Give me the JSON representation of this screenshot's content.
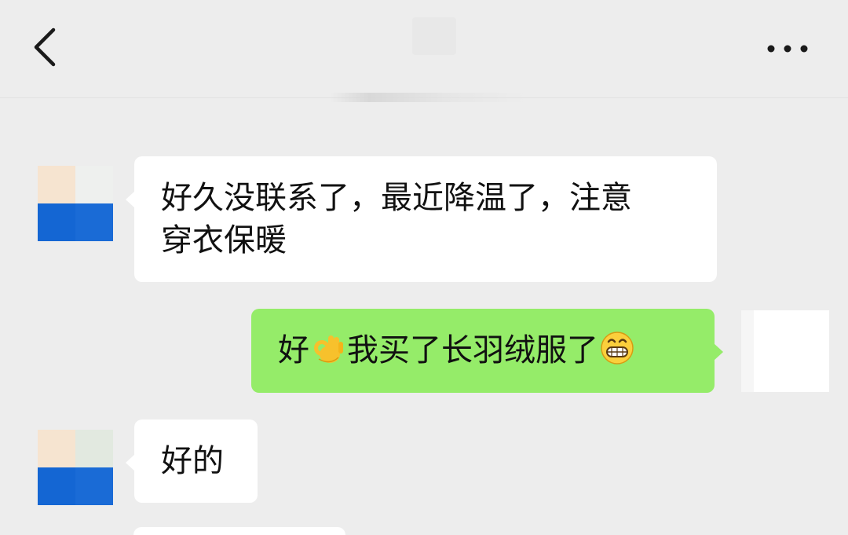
{
  "header": {
    "back_icon": "chevron-left-icon",
    "more_icon": "more-dots-icon"
  },
  "messages": [
    {
      "side": "left",
      "text_line1": "好久没联系了，最近降温了，注意",
      "text_line2": "穿衣保暖"
    },
    {
      "side": "right",
      "text_part1": "好",
      "emoji1": "ok-hand-emoji",
      "text_part2": "我买了长羽绒服了",
      "emoji2": "grinning-face-emoji"
    },
    {
      "side": "left",
      "text": "好的"
    }
  ],
  "colors": {
    "background": "#ededed",
    "self_bubble": "#95ec69",
    "other_bubble": "#ffffff",
    "avatar_blue": "#1466d3"
  }
}
